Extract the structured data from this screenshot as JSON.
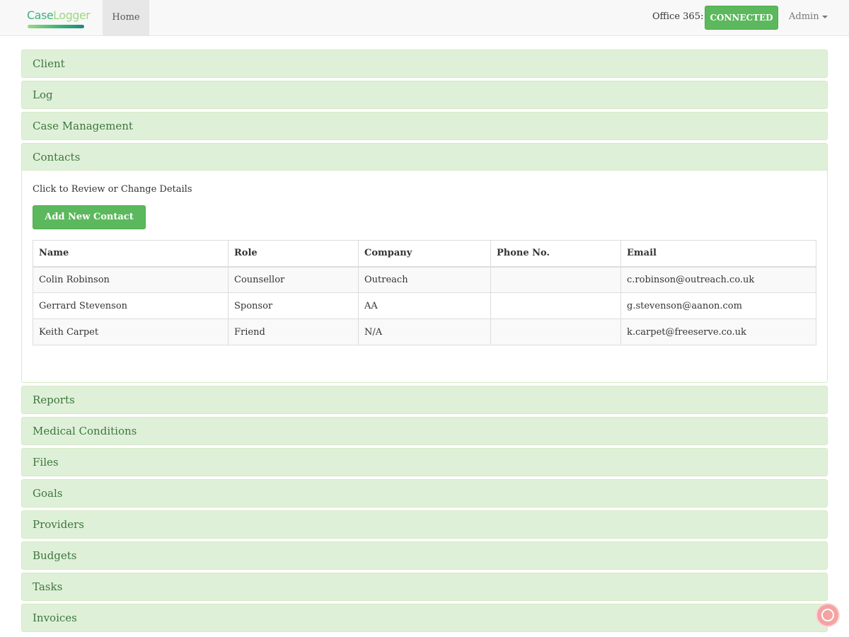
{
  "navbar": {
    "logo_case": "Case",
    "logo_logger": "Logger",
    "home_label": "Home",
    "office365_label": "Office 365:",
    "connected_label": "CONNECTED",
    "admin_label": "Admin"
  },
  "panels": [
    {
      "title": "Client"
    },
    {
      "title": "Log"
    },
    {
      "title": "Case Management"
    },
    {
      "title": "Contacts"
    },
    {
      "title": "Reports"
    },
    {
      "title": "Medical Conditions"
    },
    {
      "title": "Files"
    },
    {
      "title": "Goals"
    },
    {
      "title": "Providers"
    },
    {
      "title": "Budgets"
    },
    {
      "title": "Tasks"
    },
    {
      "title": "Invoices"
    }
  ],
  "contacts": {
    "hint": "Click to Review or Change Details",
    "add_button": "Add New Contact",
    "columns": [
      "Name",
      "Role",
      "Company",
      "Phone No.",
      "Email"
    ],
    "rows": [
      [
        "Colin Robinson",
        "Counsellor",
        "Outreach",
        "",
        "c.robinson@outreach.co.uk"
      ],
      [
        "Gerrard Stevenson",
        "Sponsor",
        "AA",
        "",
        "g.stevenson@aanon.com"
      ],
      [
        "Keith Carpet",
        "Friend",
        "N/A",
        "",
        "k.carpet@freeserve.co.uk"
      ]
    ]
  },
  "colors": {
    "panel_bg": "#dff0d8",
    "panel_border": "#d6e9c6",
    "panel_text": "#3c763d",
    "button_green": "#5cb85c"
  },
  "icons": {
    "chat": "chat-bubble-icon"
  }
}
